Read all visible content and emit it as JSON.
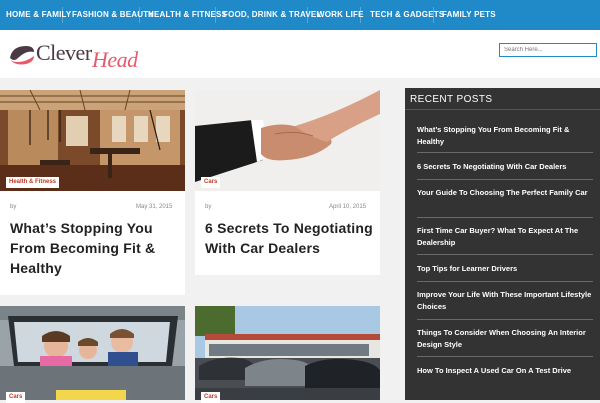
{
  "nav": {
    "items": [
      "HOME & FAMILY",
      "FASHION & BEAUTY",
      "HEALTH & FITNESS",
      "FOOD, DRINK & TRAVEL",
      "WORK LIFE",
      "TECH & GADGETS",
      "FAMILY PETS"
    ]
  },
  "logo": {
    "part1": "Clever",
    "part2": "Head"
  },
  "search": {
    "placeholder": "Search Here..."
  },
  "cards": [
    {
      "badge": "Health & Fitness",
      "by": "by",
      "date": "May 31, 2015",
      "title": "What’s Stopping You From Becoming Fit & Healthy"
    },
    {
      "badge": "Cars",
      "by": "by",
      "date": "April 10, 2015",
      "title": "6 Secrets To Negotiating With Car Dealers"
    },
    {
      "badge": "Cars"
    },
    {
      "badge": "Cars"
    }
  ],
  "sidebar": {
    "title": "RECENT POSTS",
    "posts": [
      "What’s Stopping You From Becoming Fit & Healthy",
      "6 Secrets To Negotiating With Car Dealers",
      "Your Guide To Choosing The Perfect Family Car",
      "First Time Car Buyer? What To Expect At The Dealership",
      "Top Tips for Learner Drivers",
      "Improve Your Life With These Important Lifestyle Choices",
      "Things To Consider When Choosing An Interior Design Style",
      "How To Inspect A Used Car On A Test Drive"
    ]
  },
  "colors": {
    "nav": "#1f8ac7",
    "accent": "#e85a6b",
    "badge_text": "#c0392b",
    "sidebar": "#333333"
  }
}
